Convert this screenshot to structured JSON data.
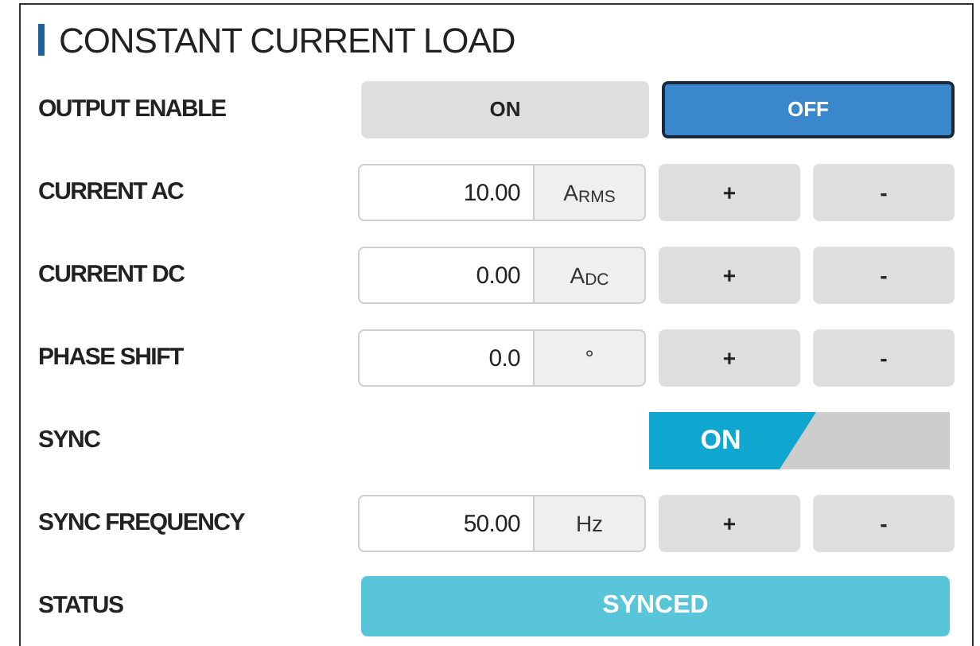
{
  "title": "CONSTANT CURRENT LOAD",
  "rows": [
    {
      "kind": "toggle",
      "label": "OUTPUT ENABLE",
      "options": [
        {
          "label": "ON",
          "selected": false
        },
        {
          "label": "OFF",
          "selected": true
        }
      ]
    },
    {
      "kind": "numeric",
      "label": "CURRENT AC",
      "value": "10.00",
      "unit": "A$_{RMS}$",
      "plus": "+",
      "minus": "-"
    },
    {
      "kind": "numeric",
      "label": "CURRENT DC",
      "value": "0.00",
      "unit": "A$_{DC}$",
      "plus": "+",
      "minus": "-"
    },
    {
      "kind": "numeric",
      "label": "PHASE SHIFT",
      "value": "0.0",
      "unit": "°",
      "plus": "+",
      "minus": "-"
    },
    {
      "kind": "switch",
      "label": "SYNC",
      "on": true,
      "text": "ON"
    },
    {
      "kind": "numeric",
      "label": "SYNC FREQUENCY",
      "value": "50.00",
      "unit": "Hz",
      "plus": "+",
      "minus": "-"
    },
    {
      "kind": "status",
      "label": "STATUS",
      "text": "SYNCED"
    }
  ]
}
